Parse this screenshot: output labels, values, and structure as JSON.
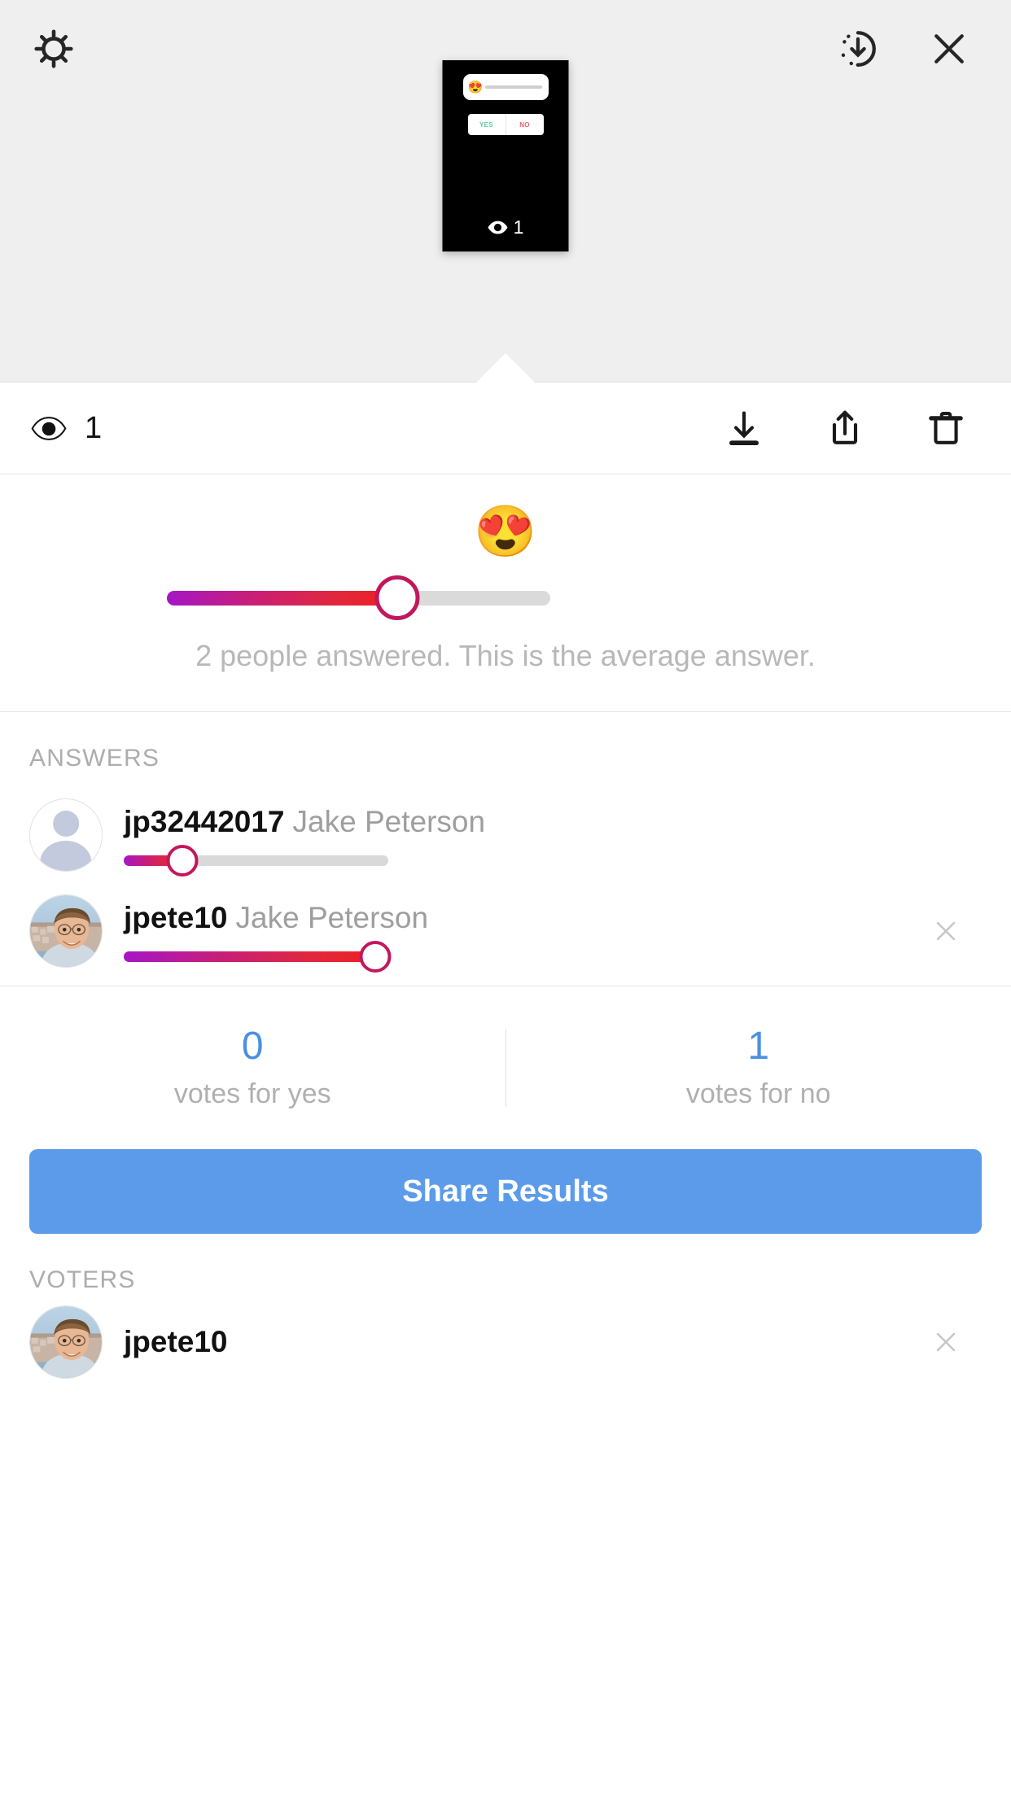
{
  "header": {
    "settings_icon": "gear-icon",
    "archive_icon": "save-archive-icon",
    "close_icon": "close-icon",
    "thumbnail": {
      "slider_emoji": "😍",
      "poll_yes": "YES",
      "poll_no": "NO",
      "views_count": "1",
      "views_icon": "eye-icon"
    }
  },
  "action_bar": {
    "views_icon": "eye-icon",
    "views_count": "1",
    "download_icon": "download-icon",
    "share_icon": "share-icon",
    "delete_icon": "trash-icon"
  },
  "slider_summary": {
    "emoji": "😍",
    "caption": "2 people answered. This is the average answer.",
    "value_percent": 60,
    "track_color_start": "#a516c6",
    "track_color_end": "#ef2020",
    "track_empty_color": "#dadada",
    "thumb_border_color": "#c2185b"
  },
  "answers": {
    "title": "ANSWERS",
    "rows": [
      {
        "username": "jp32442017",
        "fullname": "Jake Peterson",
        "value_percent": 22,
        "avatar_type": "placeholder",
        "dismiss_icon": null
      },
      {
        "username": "jpete10",
        "fullname": "Jake Peterson",
        "value_percent": 95,
        "avatar_type": "photo",
        "dismiss_icon": "close-icon"
      }
    ]
  },
  "votes": {
    "yes_count": "0",
    "yes_label": "votes for yes",
    "no_count": "1",
    "no_label": "votes for no",
    "number_color": "#4a90e2"
  },
  "share_button": {
    "label": "Share Results",
    "color": "#5b9bea"
  },
  "voters": {
    "title": "VOTERS",
    "rows": [
      {
        "username": "jpete10",
        "avatar_type": "photo",
        "dismiss_icon": "close-icon"
      }
    ]
  }
}
